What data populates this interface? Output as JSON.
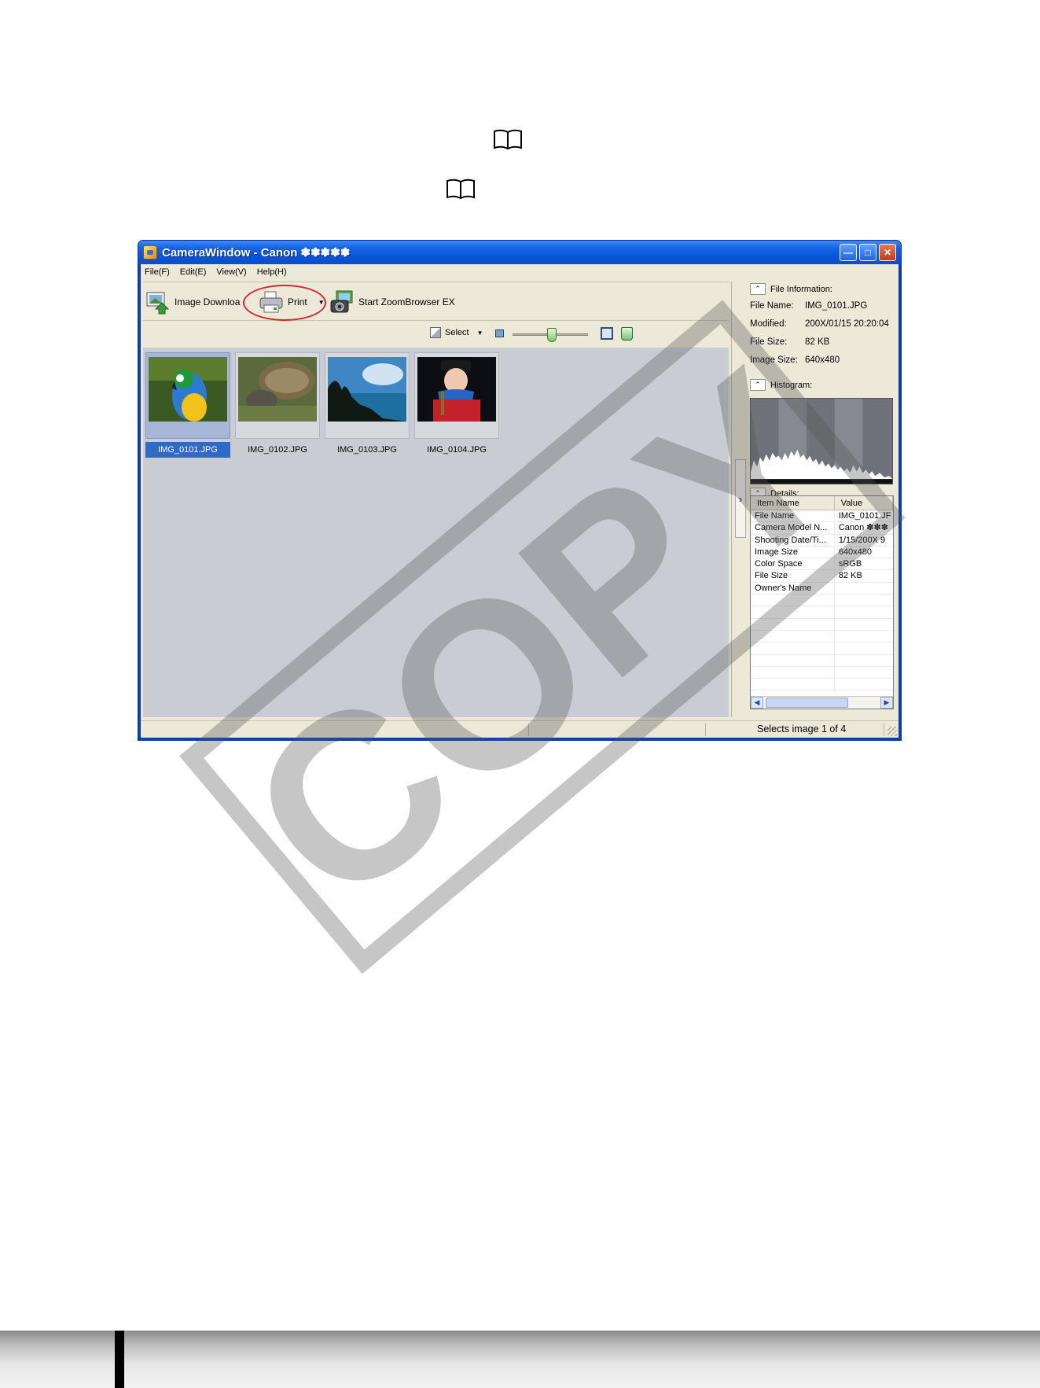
{
  "window": {
    "title": "CameraWindow - Canon ✽✽✽✽✽",
    "controls": [
      "minimize-icon",
      "maximize-icon",
      "close-icon"
    ]
  },
  "menu": [
    "File(F)",
    "Edit(E)",
    "View(V)",
    "Help(H)"
  ],
  "toolbar": {
    "image_download": "Image Downloa",
    "print": "Print",
    "zoombrowser": "Start ZoomBrowser EX",
    "select": "Select"
  },
  "thumbnails": [
    {
      "label": "IMG_0101.JPG",
      "selected": true
    },
    {
      "label": "IMG_0102.JPG",
      "selected": false
    },
    {
      "label": "IMG_0103.JPG",
      "selected": false
    },
    {
      "label": "IMG_0104.JPG",
      "selected": false
    }
  ],
  "file_info": {
    "heading": "File Information:",
    "rows": [
      {
        "key": "File Name:",
        "value": "IMG_0101.JPG"
      },
      {
        "key": "Modified:",
        "value": "200X/01/15 20:20:04"
      },
      {
        "key": "File Size:",
        "value": "82 KB"
      },
      {
        "key": "Image Size:",
        "value": "640x480"
      }
    ]
  },
  "histogram": {
    "heading": "Histogram:"
  },
  "details": {
    "heading": "Details:",
    "columns": [
      "Item Name",
      "Value"
    ],
    "rows": [
      {
        "item": "File Name",
        "value": "IMG_0101.JF"
      },
      {
        "item": "Camera Model N...",
        "value": "Canon ✽✽✽"
      },
      {
        "item": "Shooting Date/Ti...",
        "value": "1/15/200X 9"
      },
      {
        "item": "Image Size",
        "value": "640x480"
      },
      {
        "item": "Color Space",
        "value": "sRGB"
      },
      {
        "item": "File Size",
        "value": "82 KB"
      },
      {
        "item": "Owner's Name",
        "value": ""
      }
    ]
  },
  "status": {
    "text": "Selects image 1 of 4"
  },
  "watermark": "COPY"
}
